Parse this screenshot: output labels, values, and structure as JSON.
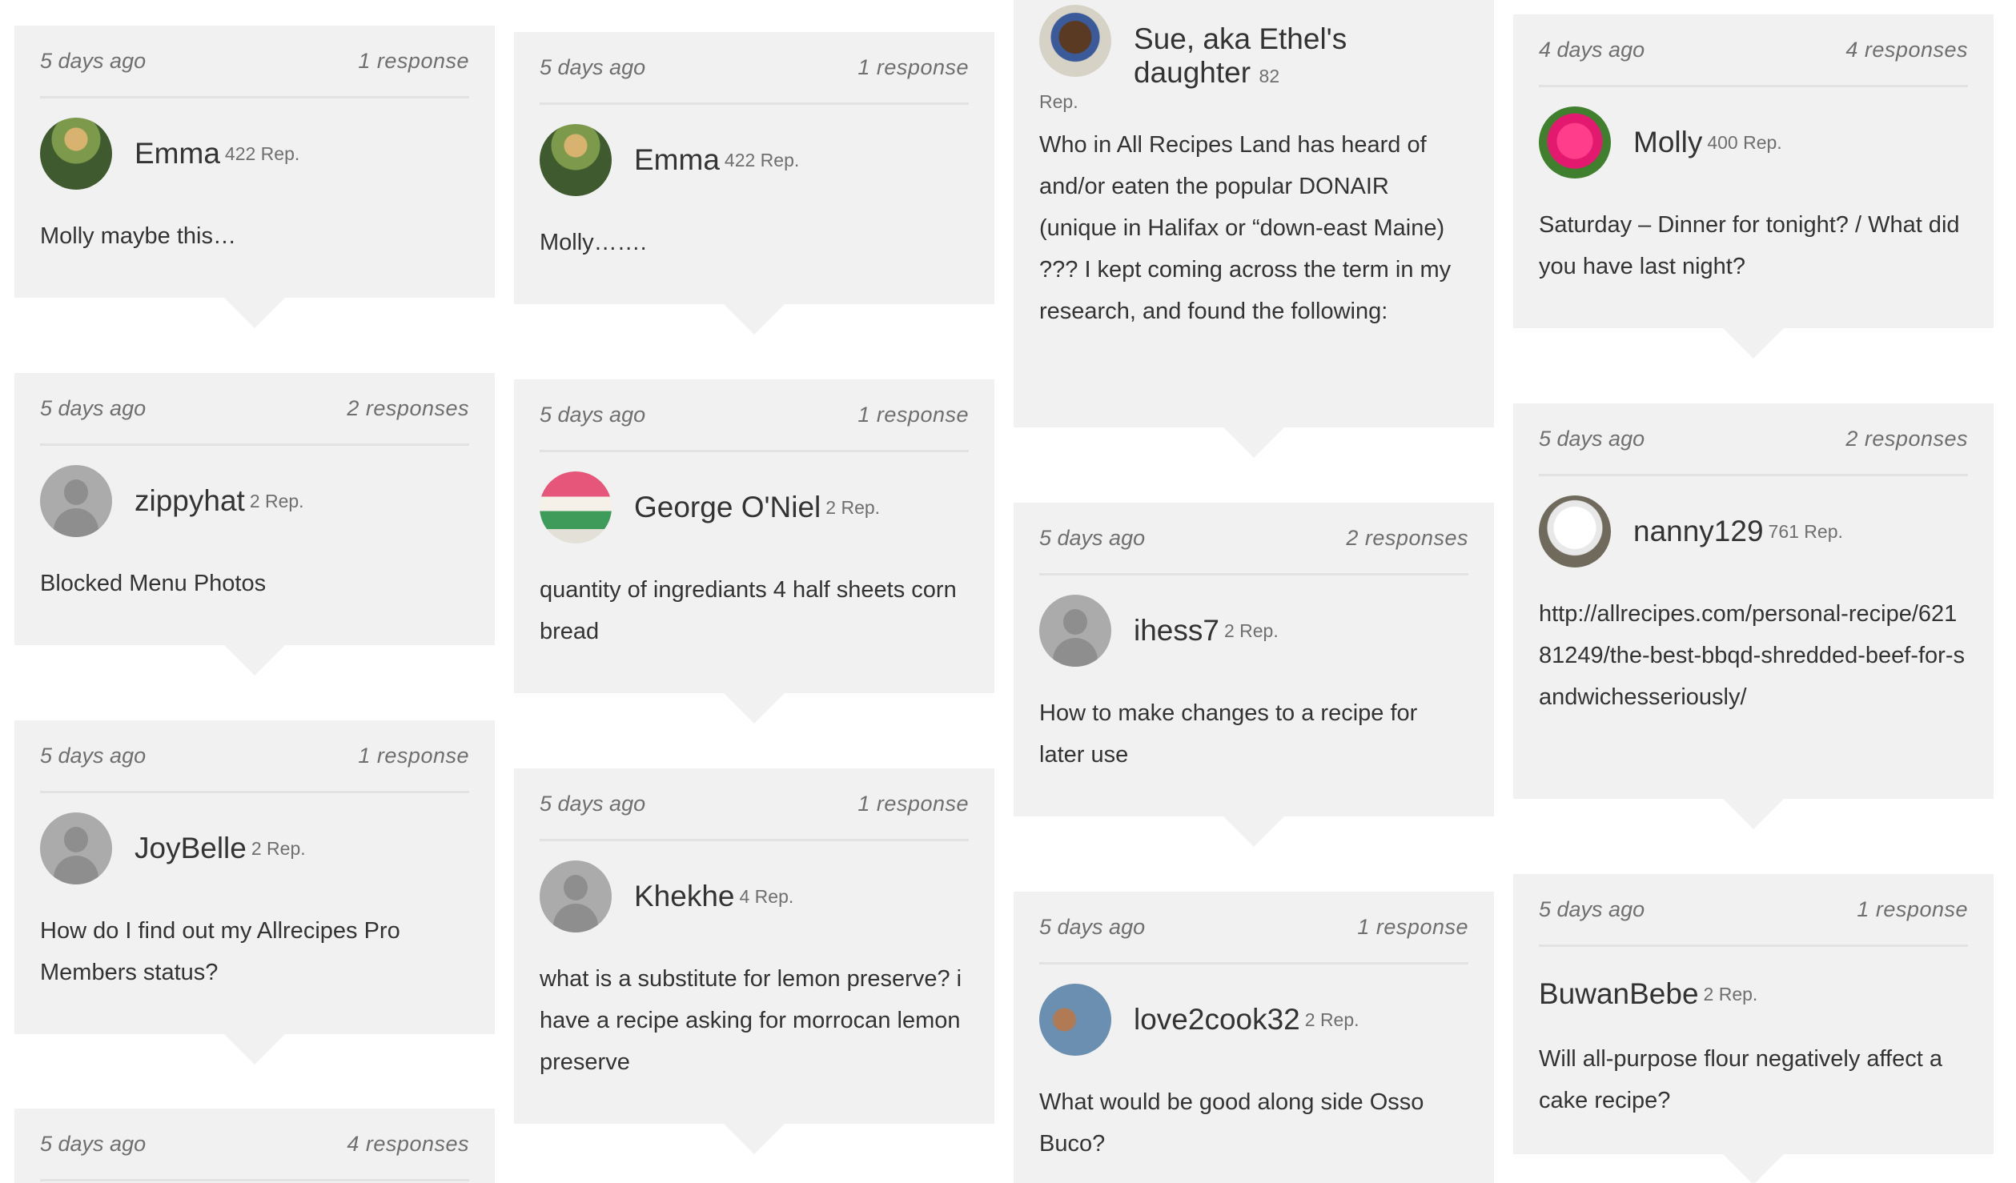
{
  "columns": [
    {
      "cards": [
        {
          "time": "5 days ago",
          "responses": "1  response",
          "name": "Emma",
          "rep": "422 Rep.",
          "body": "Molly maybe this…"
        },
        {
          "time": "5 days ago",
          "responses": "2  responses",
          "name": "zippyhat",
          "rep": "2 Rep.",
          "body": "Blocked Menu Photos"
        },
        {
          "time": "5 days ago",
          "responses": "1  response",
          "name": "JoyBelle",
          "rep": "2 Rep.",
          "body": "How do I find out my Allrecipes Pro Members status?"
        },
        {
          "time": "5 days ago",
          "responses": "4  responses"
        }
      ]
    },
    {
      "cards": [
        {
          "time": "5 days ago",
          "responses": "1  response",
          "name": "Emma",
          "rep": "422 Rep.",
          "body": "Molly……."
        },
        {
          "time": "5 days ago",
          "responses": "1  response",
          "name": "George O'Niel",
          "rep": "2 Rep.",
          "body": "quantity of ingrediants 4 half sheets corn bread"
        },
        {
          "time": "5 days ago",
          "responses": "1  response",
          "name": "Khekhe",
          "rep": "4 Rep.",
          "body": "what is a substitute for lemon preserve? i have a recipe asking for morrocan lemon preserve"
        }
      ]
    },
    {
      "cards": [
        {
          "name": "Sue, aka Ethel's daughter",
          "rep": "82",
          "rep2": "Rep.",
          "body": "Who in All Recipes Land has heard of and/or eaten the popular DONAIR (unique in Halifax or “down-east Maine) ??? I kept coming across the term in my research, and found the following:"
        },
        {
          "time": "5 days ago",
          "responses": "2  responses",
          "name": "ihess7",
          "rep": "2 Rep.",
          "body": "How to make changes to a recipe for later use"
        },
        {
          "time": "5 days ago",
          "responses": "1  response",
          "name": "love2cook32",
          "rep": "2 Rep.",
          "body": "What would be good along side Osso Buco?"
        }
      ]
    },
    {
      "cards": [
        {
          "time": "4 days ago",
          "responses": "4  responses",
          "name": "Molly",
          "rep": "400 Rep.",
          "body": "Saturday – Dinner for tonight? / What did you have last night?"
        },
        {
          "time": "5 days ago",
          "responses": "2  responses",
          "name": "nanny129",
          "rep": "761 Rep.",
          "body": "http://allrecipes.com/personal-recipe/62181249/the-best-bbqd-shredded-beef-for-sandwichesseriously/"
        },
        {
          "time": "5 days ago",
          "responses": "1  response",
          "name": "BuwanBebe",
          "rep": "2 Rep.",
          "body": "Will all-purpose flour negatively affect a cake recipe?"
        }
      ]
    }
  ],
  "icons": {
    "default_avatar": "default-user-icon"
  },
  "colors": {
    "card_bg": "#f1f1f1",
    "divider": "#e2e2e2",
    "meta_text": "#6f6f6f",
    "body_text": "#333333"
  }
}
